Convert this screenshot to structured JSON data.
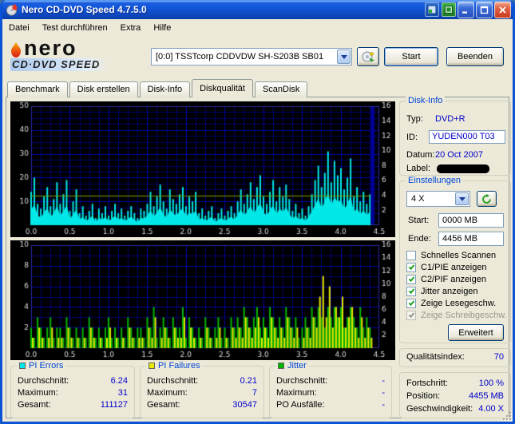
{
  "window": {
    "title": "Nero CD-DVD Speed 4.7.5.0"
  },
  "icons": {
    "app_icon": "nero-disc-flame",
    "titlebar_extra_1": "blue-app-icon",
    "titlebar_extra_2": "green-app-icon",
    "minimize": "minimize",
    "maximize": "maximize",
    "close": "close",
    "combo_arrow": "chevron-down",
    "drive_button": "disc-eject",
    "refresh": "refresh-arrows",
    "resize": "resize-grip"
  },
  "menu": {
    "items": [
      {
        "label": "Datei"
      },
      {
        "label": "Test durchführen"
      },
      {
        "label": "Extra"
      },
      {
        "label": "Hilfe"
      }
    ]
  },
  "logo": {
    "line1": "nero",
    "line2": "CD·DVD SPEED"
  },
  "drive_bar": {
    "drive": "[0:0]  TSSTcorp CDDVDW SH-S203B SB01",
    "start_button": "Start",
    "quit_button": "Beenden"
  },
  "tabs": {
    "items": [
      {
        "label": "Benchmark",
        "active": false
      },
      {
        "label": "Disk erstellen",
        "active": false
      },
      {
        "label": "Disk-Info",
        "active": false
      },
      {
        "label": "Diskqualität",
        "active": true
      },
      {
        "label": "ScanDisk",
        "active": false
      }
    ]
  },
  "disk_info": {
    "title": "Disk-Info",
    "typ_label": "Typ:",
    "typ_value": "DVD+R",
    "id_label": "ID:",
    "id_value": "YUDEN000 T03",
    "datum_label": "Datum:",
    "datum_value": "20 Oct 2007",
    "label_label": "Label:",
    "label_value": ""
  },
  "settings": {
    "title": "Einstellungen",
    "speed_value": "4 X",
    "start_label": "Start:",
    "start_value": "0000 MB",
    "end_label": "Ende:",
    "end_value": "4456 MB",
    "checkboxes": [
      {
        "label": "Schnelles Scannen",
        "checked": false,
        "disabled": false
      },
      {
        "label": "C1/PIE anzeigen",
        "checked": true,
        "disabled": false
      },
      {
        "label": "C2/PIF anzeigen",
        "checked": true,
        "disabled": false
      },
      {
        "label": "Jitter anzeigen",
        "checked": true,
        "disabled": false
      },
      {
        "label": "Zeige Lesegeschw.",
        "checked": true,
        "disabled": false
      },
      {
        "label": "Zeige Schreibgeschw.",
        "checked": true,
        "disabled": true
      }
    ],
    "advanced_button": "Erweitert"
  },
  "quality": {
    "label": "Qualitätsindex:",
    "value": "70"
  },
  "progress": {
    "rows": [
      {
        "label": "Fortschritt:",
        "value": "100 %"
      },
      {
        "label": "Position:",
        "value": "4455 MB"
      },
      {
        "label": "Geschwindigkeit:",
        "value": "4.00 X"
      }
    ]
  },
  "stats": [
    {
      "title": "PI Errors",
      "color": "#00E8E8",
      "rows": [
        [
          "Durchschnitt:",
          "6.24"
        ],
        [
          "Maximum:",
          "31"
        ],
        [
          "Gesamt:",
          "111127"
        ]
      ]
    },
    {
      "title": "PI Failures",
      "color": "#E8E800",
      "rows": [
        [
          "Durchschnitt:",
          "0.21"
        ],
        [
          "Maximum:",
          "7"
        ],
        [
          "Gesamt:",
          "30547"
        ]
      ]
    },
    {
      "title": "Jitter",
      "color": "#00B400",
      "rows": [
        [
          "Durchschnitt:",
          "-"
        ],
        [
          "Maximum:",
          "-"
        ],
        [
          "PO Ausfälle:",
          "-"
        ]
      ]
    }
  ],
  "chart_data": [
    {
      "type": "area",
      "name": "pie_quality_scan",
      "xlim": [
        0,
        4.5
      ],
      "ylim": [
        0,
        50
      ],
      "right_lim": [
        0,
        16
      ],
      "x_ticks": [
        "0.0",
        "0.5",
        "1.0",
        "1.5",
        "2.0",
        "2.5",
        "3.0",
        "3.5",
        "4.0",
        "4.5"
      ],
      "left_ticks": [
        50,
        40,
        30,
        20,
        10
      ],
      "right_ticks": [
        16,
        14,
        12,
        10,
        8,
        6,
        4,
        2
      ],
      "x_grid_step": 0.125,
      "x_major": 0.5,
      "y_grid_step": 2.5,
      "grid_minor": "#00006E",
      "grid_major": "#0000A8",
      "frame_color": "#2828A0",
      "label_color": "#DCDCDC",
      "data_end": 4.38,
      "speed_line": {
        "value": 4,
        "color": "#7FA000"
      },
      "end_marker": {
        "x": 4.39,
        "width": 0.05,
        "color": "#000096"
      },
      "series": [
        {
          "name": "PI Errors",
          "color": "#00E8E8",
          "width": 2,
          "fill": 0.45,
          "values": [
            14,
            20,
            9,
            7,
            12,
            16,
            8,
            11,
            18,
            9,
            13,
            19,
            6,
            10,
            15,
            5,
            8,
            4,
            6,
            9,
            3,
            7,
            5,
            8,
            4,
            6,
            9,
            5,
            7,
            4,
            6,
            8,
            5,
            3,
            7,
            6,
            9,
            14,
            8,
            12,
            17,
            10,
            7,
            15,
            11,
            9,
            13,
            16,
            8,
            12,
            10,
            14,
            5,
            7,
            4,
            6,
            8,
            3,
            5,
            7,
            4,
            6,
            8,
            5,
            10,
            15,
            9,
            13,
            18,
            11,
            16,
            21,
            12,
            9,
            14,
            19,
            10,
            16,
            12,
            17,
            11,
            6,
            9,
            5,
            7,
            4,
            8,
            13,
            19,
            25,
            16,
            22,
            31,
            18,
            27,
            21,
            24,
            15,
            20,
            28,
            12,
            16,
            10,
            14,
            9,
            13
          ]
        }
      ]
    },
    {
      "type": "area",
      "name": "pif_jitter_quality_scan",
      "xlim": [
        0,
        4.5
      ],
      "ylim": [
        0,
        10
      ],
      "right_lim": [
        0,
        16
      ],
      "x_ticks": [
        "0.0",
        "0.5",
        "1.0",
        "1.5",
        "2.0",
        "2.5",
        "3.0",
        "3.5",
        "4.0",
        "4.5"
      ],
      "left_ticks": [
        10,
        8,
        6,
        4,
        2
      ],
      "right_ticks": [
        16,
        14,
        12,
        10,
        8,
        6,
        4,
        2
      ],
      "x_grid_step": 0.125,
      "x_major": 0.5,
      "y_grid_step": 1,
      "grid_minor": "#00006E",
      "grid_major": "#0000A8",
      "frame_color": "#2828A0",
      "label_color": "#DCDCDC",
      "data_end": 4.38,
      "series": [
        {
          "name": "Jitter",
          "color": "#00B400",
          "width": 2,
          "values": [
            2,
            1,
            3,
            2,
            1,
            2,
            3,
            1,
            2,
            2,
            1,
            3,
            2,
            1,
            2,
            1,
            2,
            1,
            3,
            2,
            1,
            2,
            1,
            2,
            3,
            1,
            2,
            1,
            2,
            1,
            3,
            2,
            1,
            2,
            2,
            1,
            3,
            2,
            4,
            1,
            2,
            3,
            2,
            1,
            3,
            2,
            2,
            4,
            1,
            3,
            2,
            1,
            2,
            1,
            3,
            2,
            1,
            2,
            3,
            1,
            2,
            1,
            3,
            2,
            3,
            2,
            4,
            3,
            2,
            3,
            4,
            2,
            3,
            2,
            4,
            3,
            2,
            3,
            2,
            4,
            3,
            2,
            3,
            1,
            2,
            3,
            2,
            4,
            3,
            4,
            3,
            2,
            4,
            3,
            4,
            3,
            4,
            2,
            3,
            4,
            3,
            2,
            4,
            2,
            3,
            2
          ]
        },
        {
          "name": "PI Failures",
          "color": "#E8E800",
          "width": 2,
          "offset": 2,
          "values": [
            1,
            0,
            2,
            1,
            0,
            1,
            2,
            0,
            1,
            1,
            0,
            2,
            1,
            0,
            1,
            0,
            1,
            0,
            2,
            1,
            0,
            1,
            0,
            1,
            2,
            0,
            1,
            0,
            1,
            0,
            2,
            1,
            0,
            1,
            1,
            0,
            2,
            1,
            3,
            0,
            1,
            2,
            1,
            0,
            2,
            1,
            1,
            3,
            0,
            2,
            1,
            0,
            1,
            0,
            2,
            1,
            0,
            1,
            2,
            0,
            1,
            0,
            2,
            1,
            2,
            1,
            3,
            2,
            1,
            2,
            3,
            1,
            2,
            1,
            3,
            2,
            1,
            2,
            1,
            3,
            2,
            1,
            2,
            0,
            1,
            2,
            1,
            3,
            2,
            5,
            7,
            3,
            6,
            2,
            4,
            3,
            5,
            2,
            3,
            4,
            2,
            1,
            3,
            1,
            2,
            1
          ]
        }
      ]
    }
  ]
}
